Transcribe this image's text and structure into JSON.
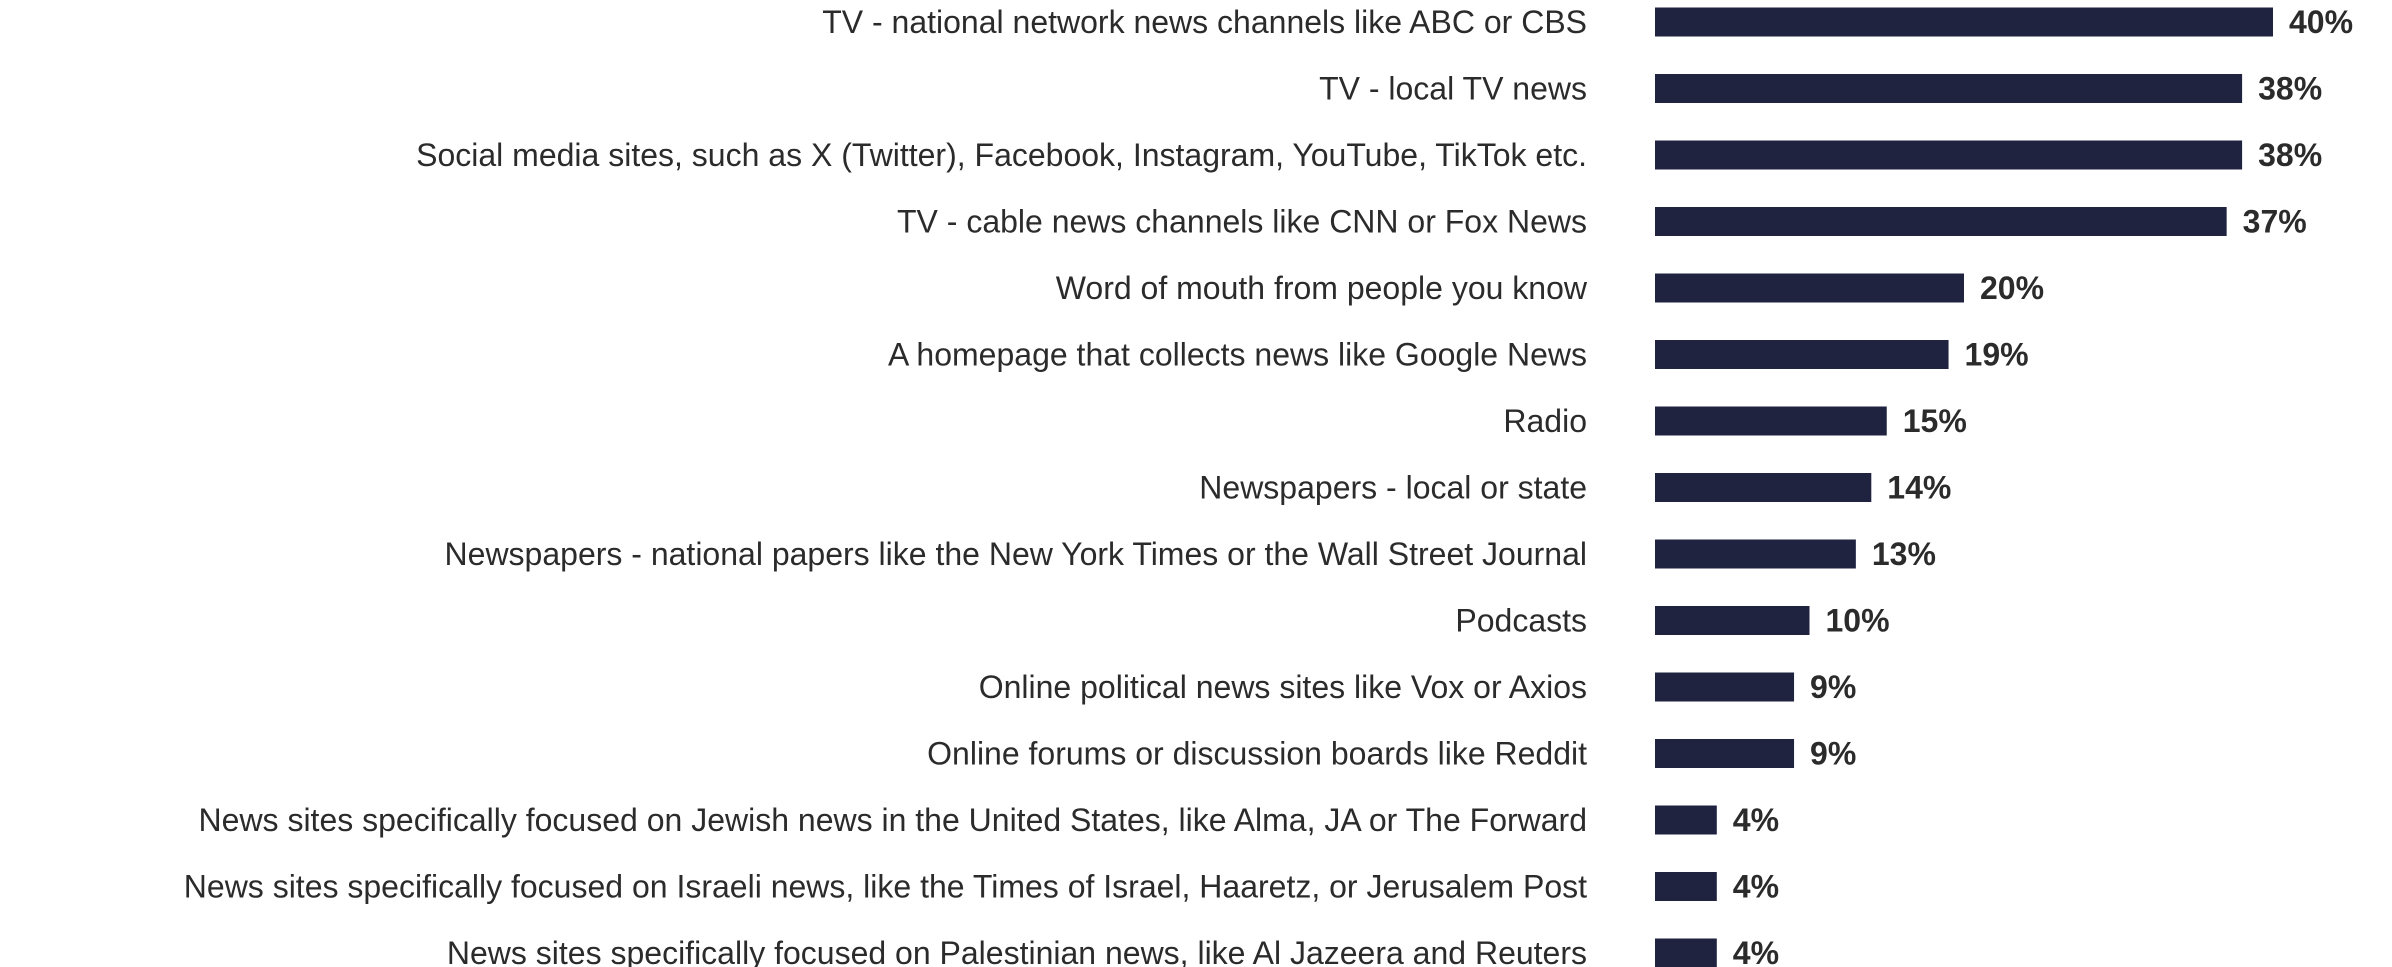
{
  "chart_data": {
    "type": "bar",
    "orientation": "horizontal",
    "categories": [
      "TV - national network news channels like ABC or CBS",
      "TV - local TV news",
      "Social media sites, such as X (Twitter), Facebook, Instagram, YouTube, TikTok etc.",
      "TV - cable news channels like CNN or Fox News",
      "Word of mouth from people you know",
      "A homepage that collects news like Google News",
      "Radio",
      "Newspapers - local or state",
      "Newspapers - national papers like the New York Times or the Wall Street Journal",
      "Podcasts",
      "Online political news sites like Vox or Axios",
      "Online forums or discussion boards like Reddit",
      "News sites specifically focused on Jewish news in the United States, like Alma, JA or The Forward",
      "News sites specifically focused on Israeli news, like the Times of Israel, Haaretz, or Jerusalem Post",
      "News sites specifically focused on Palestinian news, like Al Jazeera and Reuters"
    ],
    "values": [
      40,
      38,
      38,
      37,
      20,
      19,
      15,
      14,
      13,
      10,
      9,
      9,
      4,
      4,
      4
    ],
    "value_labels": [
      "40%",
      "38%",
      "38%",
      "37%",
      "20%",
      "19%",
      "15%",
      "14%",
      "13%",
      "10%",
      "9%",
      "9%",
      "4%",
      "4%",
      "4%"
    ],
    "bar_color": "#1f2340",
    "text_color": "#2b2b2b",
    "xlim": [
      0,
      40
    ],
    "grid": false,
    "legend": "none"
  }
}
